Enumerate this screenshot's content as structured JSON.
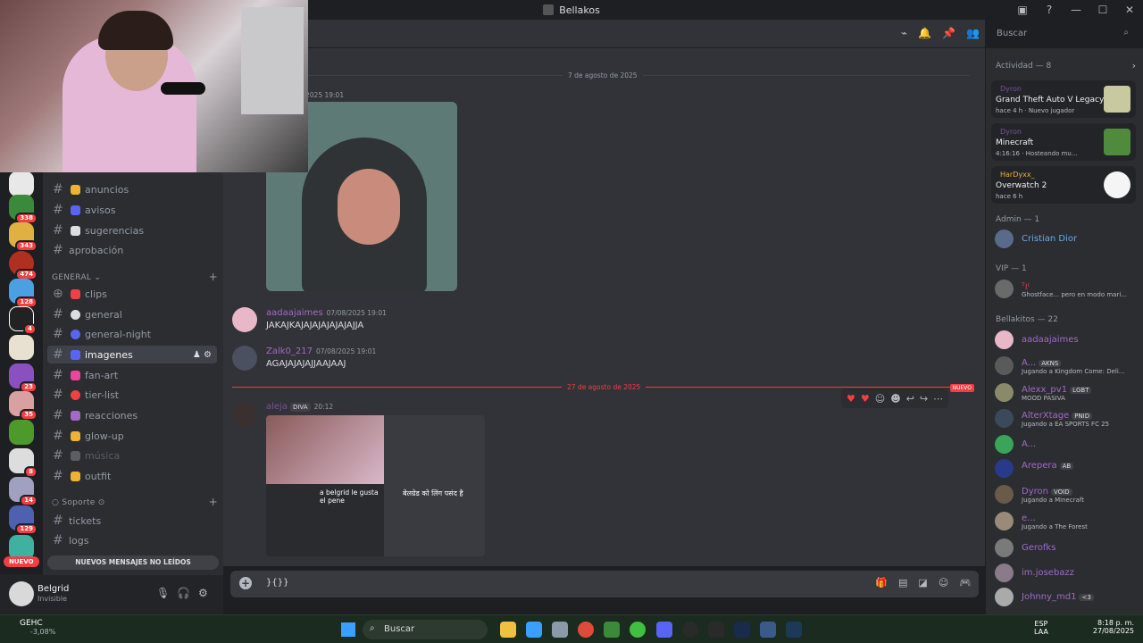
{
  "window": {
    "title": "Bellakos"
  },
  "server_rail": {
    "badges": [
      "338",
      "343",
      "474",
      "128",
      "4",
      "23",
      "35",
      "8",
      "14",
      "129"
    ],
    "nuevo_label": "NUEVO"
  },
  "channels": {
    "top": [
      {
        "name": "anuncios",
        "emoji_color": "#f0b232"
      },
      {
        "name": "avisos",
        "emoji_color": "#5865f2"
      },
      {
        "name": "sugerencias",
        "emoji_color": "#dbdee1"
      },
      {
        "name": "aprobación",
        "emoji_color": ""
      }
    ],
    "general_category": "GENERAL",
    "general": [
      {
        "name": "clips",
        "emoji_color": "#f23f42"
      },
      {
        "name": "general",
        "emoji_color": "#dbdee1"
      },
      {
        "name": "general-night",
        "emoji_color": "#5865f2"
      },
      {
        "name": "imagenes",
        "emoji_color": "#5865f2"
      },
      {
        "name": "fan-art",
        "emoji_color": "#eb459e"
      },
      {
        "name": "tier-list",
        "emoji_color": "#f23f42"
      },
      {
        "name": "reacciones",
        "emoji_color": "#a468c9"
      },
      {
        "name": "glow-up",
        "emoji_color": "#f0b232"
      },
      {
        "name": "música",
        "emoji_color": "#5c5e66"
      },
      {
        "name": "outfit",
        "emoji_color": "#f0b232"
      }
    ],
    "soporte_category": "Soporte",
    "soporte": [
      {
        "name": "tickets"
      },
      {
        "name": "logs"
      }
    ],
    "unread_banner": "NUEVOS MENSAJES NO LEÍDOS"
  },
  "user_panel": {
    "name": "Belgrid",
    "status": "Invisible"
  },
  "search": {
    "placeholder": "Buscar"
  },
  "chat": {
    "divider_1": "7 de agosto de 2025",
    "first_time": "2025 19:01",
    "messages": [
      {
        "author": "aadaajaimes",
        "time": "07/08/2025 19:01",
        "text": "JAKAJKAJAJAJAJAJAJAJJA"
      },
      {
        "author": "Zalk0_217",
        "time": "07/08/2025 19:01",
        "text": "AGAJAJAJAJJAAJAAJ"
      }
    ],
    "divider_2": "27 de agosto de 2025",
    "new_tag": "NUEVO",
    "last_message": {
      "author": "aleja",
      "role": "DIVA",
      "time": "20:12",
      "image_text_1": "a belgrid le gusta el pene",
      "image_text_2": "बेलग्रेड को लिंग पसंद है"
    }
  },
  "composer": {
    "draft": "}{}}"
  },
  "members": {
    "activity_title": "Actividad — 8",
    "activities": [
      {
        "user": "Dyron",
        "game": "Grand Theft Auto V Legacy",
        "meta": "hace 4 h  ·  Nuevo jugador",
        "thumb_color": "#c9c9a0"
      },
      {
        "user": "Dyron",
        "game": "Minecraft",
        "meta": "4:16:16  ·  Hosteando mu...",
        "thumb_color": "#4f8a3d"
      },
      {
        "user": "HarDyxx_",
        "game": "Overwatch 2",
        "meta": "hace 6 h",
        "thumb_color": "#f5f5f5"
      }
    ],
    "admin_title": "Admin — 1",
    "admin": [
      {
        "name": "Cristian Dior",
        "color": "#6aa8e8"
      }
    ],
    "vip_title": "VIP — 1",
    "vip": [
      {
        "name": "ᵀ౹ᶦ",
        "sub": "Ghostface... pero en modo mari...",
        "color": "#f23f42"
      }
    ],
    "bellakitos_title": "Bellakitos — 22",
    "bellakitos": [
      {
        "name": "aadaajaimes",
        "tag": "",
        "sub": ""
      },
      {
        "name": "A...",
        "tag": "AKNS",
        "sub": "Jugando a Kingdom Come: Deli..."
      },
      {
        "name": "Alexx_pv1",
        "tag": "LGBT",
        "sub": "MOOD PASIVA"
      },
      {
        "name": "AlterXtage",
        "tag": "PNID",
        "sub": "Jugando a EA SPORTS FC 25"
      },
      {
        "name": "A...",
        "tag": "",
        "sub": ""
      },
      {
        "name": "Arepera",
        "tag": "AB",
        "sub": ""
      },
      {
        "name": "Dyron",
        "tag": "VOID",
        "sub": "Jugando a Minecraft"
      },
      {
        "name": "e...",
        "tag": "",
        "sub": "Jugando a The Forest"
      },
      {
        "name": "Gerofks",
        "tag": "",
        "sub": ""
      },
      {
        "name": "im.josebazz",
        "tag": "",
        "sub": ""
      },
      {
        "name": "Johnny_md1",
        "tag": "<3",
        "sub": ""
      }
    ]
  },
  "taskbar": {
    "weather_label": "GEHC",
    "weather_value": "-3,08%",
    "search_label": "Buscar",
    "lang": "ESP",
    "lang_sub": "LAA",
    "time": "8:18 p. m.",
    "date": "27/08/2025"
  },
  "colors": {
    "accent": "#5865f2",
    "danger": "#f23f42",
    "bg": "#313338",
    "sidebar": "#2b2d31"
  }
}
